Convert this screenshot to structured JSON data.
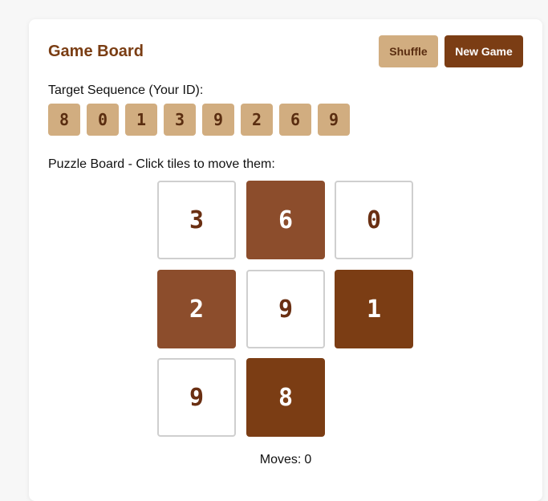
{
  "header": {
    "title": "Game Board",
    "shuffle_label": "Shuffle",
    "new_game_label": "New Game"
  },
  "target": {
    "label": "Target Sequence (Your ID):",
    "digits": [
      "8",
      "0",
      "1",
      "3",
      "9",
      "2",
      "6",
      "9"
    ]
  },
  "board": {
    "label": "Puzzle Board - Click tiles to move them:",
    "tiles": [
      {
        "value": "3",
        "style": "white"
      },
      {
        "value": "6",
        "style": "medium"
      },
      {
        "value": "0",
        "style": "white"
      },
      {
        "value": "2",
        "style": "medium"
      },
      {
        "value": "9",
        "style": "white"
      },
      {
        "value": "1",
        "style": "dark"
      },
      {
        "value": "9",
        "style": "white"
      },
      {
        "value": "8",
        "style": "dark"
      },
      {
        "value": "",
        "style": "empty"
      }
    ]
  },
  "status": {
    "moves_label": "Moves:",
    "moves_value": "0"
  },
  "colors": {
    "accent_dark": "#7b3d14",
    "accent_light": "#d1ad80",
    "tile_medium": "#8c4d2c",
    "tile_border": "#cfcfcf"
  }
}
